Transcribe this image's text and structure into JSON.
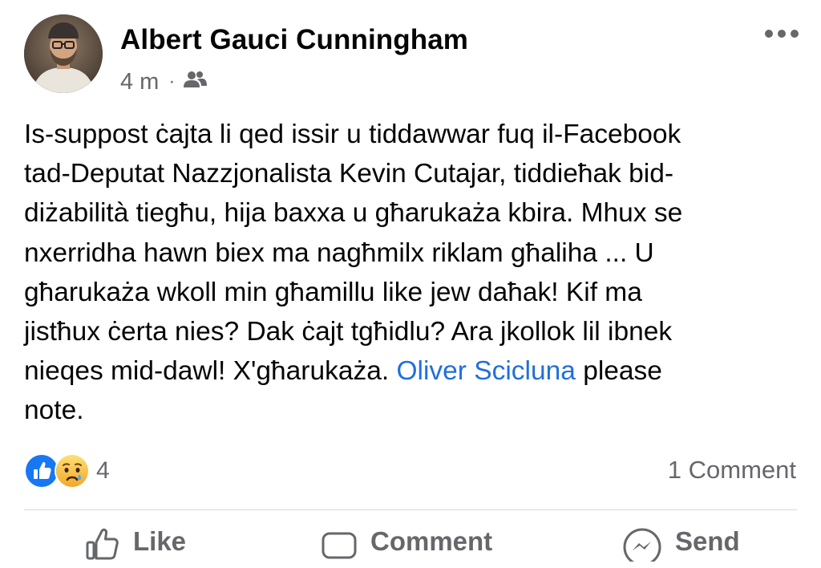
{
  "post": {
    "author": "Albert Gauci Cunningham",
    "timestamp": "4 m",
    "separator": "·",
    "audience_icon": "friends-icon",
    "more_icon": "more-options-icon",
    "text_lines": [
      "Is-suppost ċajta li qed issir u tiddawwar fuq il-Facebook",
      "tad-Deputat Nazzjonalista Kevin Cutajar, tiddieħak bid-",
      "diżabilità tiegħu, hija baxxa u għarukaża kbira.  Mhux se",
      "nxerridha hawn biex ma nagħmilx riklam għaliha ... U",
      "għarukaża wkoll min għamillu like jew daħak!  Kif ma",
      "jistħux ċerta nies?  Dak ċajt tgħidlu?  Ara jkollok lil ibnek"
    ],
    "line7_before": "nieqes mid-dawl! X'għarukaża. ",
    "mention": "Oliver Scicluna",
    "line7_after": " please",
    "line8": "note."
  },
  "reactions": {
    "icons": [
      "like-reaction-icon",
      "sad-reaction-icon"
    ],
    "count": "4",
    "comment_count": "1 Comment"
  },
  "actions": {
    "like_label": "Like",
    "comment_label": "Comment",
    "send_label": "Send"
  },
  "colors": {
    "text": "#050505",
    "secondary": "#65676b",
    "link": "#216fdb",
    "like_blue": "#1877f2",
    "sad_yellow": "#f7b928",
    "divider": "#d8dadf"
  }
}
